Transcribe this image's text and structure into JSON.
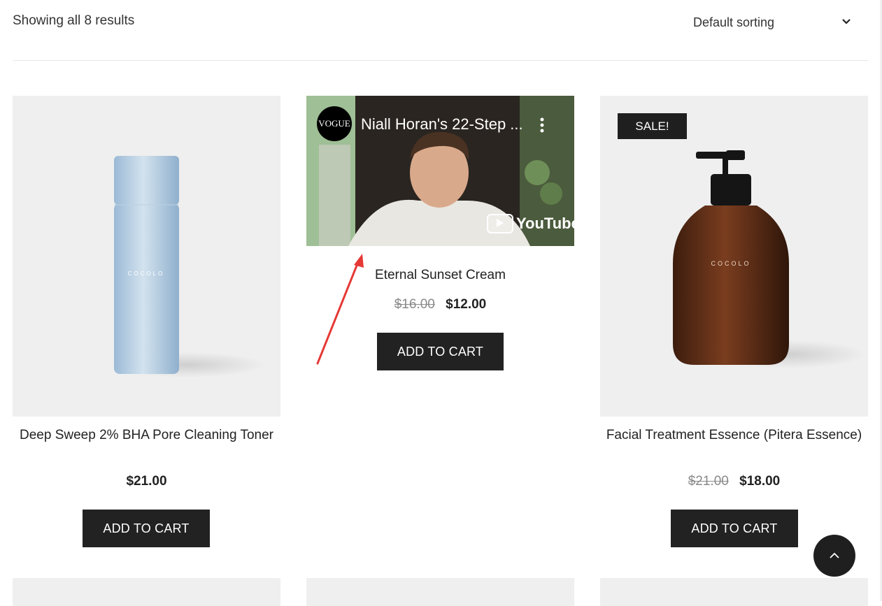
{
  "toolbar": {
    "result_count": "Showing all 8 results",
    "sorting": "Default sorting"
  },
  "products": [
    {
      "title": "Deep Sweep 2% BHA Pore Cleaning Toner",
      "price": "$21.00",
      "button": "ADD TO CART",
      "brand": "COCOLO"
    },
    {
      "title": "Eternal Sunset Cream",
      "old_price": "$16.00",
      "price": "$12.00",
      "button": "ADD TO CART",
      "video": {
        "channel": "VOGUE",
        "title": "Niall Horan's 22-Step ...",
        "platform": "YouTube"
      }
    },
    {
      "title": "Facial Treatment Essence (Pitera Essence)",
      "old_price": "$21.00",
      "price": "$18.00",
      "button": "ADD TO CART",
      "badge": "SALE!",
      "brand": "COCOLO"
    }
  ],
  "colors": {
    "dark": "#222222",
    "tile_bg": "#efefef",
    "arrow": "#e53935"
  }
}
